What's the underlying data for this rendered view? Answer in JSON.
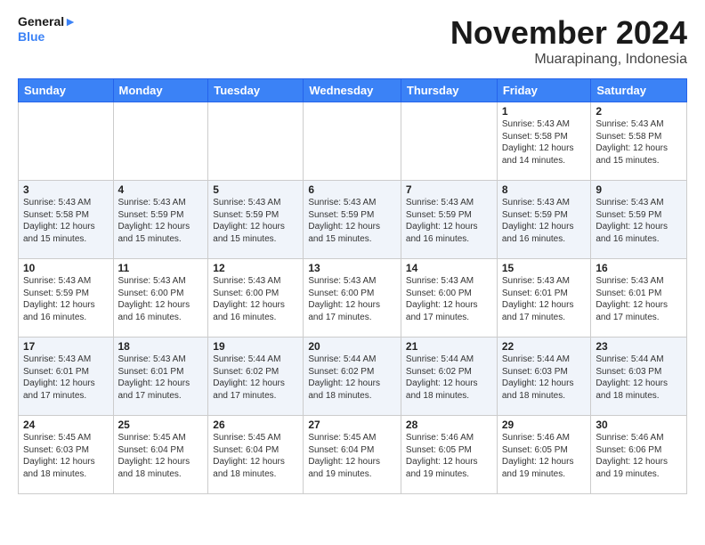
{
  "logo": {
    "line1": "General",
    "line2": "Blue"
  },
  "title": "November 2024",
  "location": "Muarapinang, Indonesia",
  "weekdays": [
    "Sunday",
    "Monday",
    "Tuesday",
    "Wednesday",
    "Thursday",
    "Friday",
    "Saturday"
  ],
  "weeks": [
    [
      {
        "day": "",
        "info": ""
      },
      {
        "day": "",
        "info": ""
      },
      {
        "day": "",
        "info": ""
      },
      {
        "day": "",
        "info": ""
      },
      {
        "day": "",
        "info": ""
      },
      {
        "day": "1",
        "info": "Sunrise: 5:43 AM\nSunset: 5:58 PM\nDaylight: 12 hours and 14 minutes."
      },
      {
        "day": "2",
        "info": "Sunrise: 5:43 AM\nSunset: 5:58 PM\nDaylight: 12 hours and 15 minutes."
      }
    ],
    [
      {
        "day": "3",
        "info": "Sunrise: 5:43 AM\nSunset: 5:58 PM\nDaylight: 12 hours and 15 minutes."
      },
      {
        "day": "4",
        "info": "Sunrise: 5:43 AM\nSunset: 5:59 PM\nDaylight: 12 hours and 15 minutes."
      },
      {
        "day": "5",
        "info": "Sunrise: 5:43 AM\nSunset: 5:59 PM\nDaylight: 12 hours and 15 minutes."
      },
      {
        "day": "6",
        "info": "Sunrise: 5:43 AM\nSunset: 5:59 PM\nDaylight: 12 hours and 15 minutes."
      },
      {
        "day": "7",
        "info": "Sunrise: 5:43 AM\nSunset: 5:59 PM\nDaylight: 12 hours and 16 minutes."
      },
      {
        "day": "8",
        "info": "Sunrise: 5:43 AM\nSunset: 5:59 PM\nDaylight: 12 hours and 16 minutes."
      },
      {
        "day": "9",
        "info": "Sunrise: 5:43 AM\nSunset: 5:59 PM\nDaylight: 12 hours and 16 minutes."
      }
    ],
    [
      {
        "day": "10",
        "info": "Sunrise: 5:43 AM\nSunset: 5:59 PM\nDaylight: 12 hours and 16 minutes."
      },
      {
        "day": "11",
        "info": "Sunrise: 5:43 AM\nSunset: 6:00 PM\nDaylight: 12 hours and 16 minutes."
      },
      {
        "day": "12",
        "info": "Sunrise: 5:43 AM\nSunset: 6:00 PM\nDaylight: 12 hours and 16 minutes."
      },
      {
        "day": "13",
        "info": "Sunrise: 5:43 AM\nSunset: 6:00 PM\nDaylight: 12 hours and 17 minutes."
      },
      {
        "day": "14",
        "info": "Sunrise: 5:43 AM\nSunset: 6:00 PM\nDaylight: 12 hours and 17 minutes."
      },
      {
        "day": "15",
        "info": "Sunrise: 5:43 AM\nSunset: 6:01 PM\nDaylight: 12 hours and 17 minutes."
      },
      {
        "day": "16",
        "info": "Sunrise: 5:43 AM\nSunset: 6:01 PM\nDaylight: 12 hours and 17 minutes."
      }
    ],
    [
      {
        "day": "17",
        "info": "Sunrise: 5:43 AM\nSunset: 6:01 PM\nDaylight: 12 hours and 17 minutes."
      },
      {
        "day": "18",
        "info": "Sunrise: 5:43 AM\nSunset: 6:01 PM\nDaylight: 12 hours and 17 minutes."
      },
      {
        "day": "19",
        "info": "Sunrise: 5:44 AM\nSunset: 6:02 PM\nDaylight: 12 hours and 17 minutes."
      },
      {
        "day": "20",
        "info": "Sunrise: 5:44 AM\nSunset: 6:02 PM\nDaylight: 12 hours and 18 minutes."
      },
      {
        "day": "21",
        "info": "Sunrise: 5:44 AM\nSunset: 6:02 PM\nDaylight: 12 hours and 18 minutes."
      },
      {
        "day": "22",
        "info": "Sunrise: 5:44 AM\nSunset: 6:03 PM\nDaylight: 12 hours and 18 minutes."
      },
      {
        "day": "23",
        "info": "Sunrise: 5:44 AM\nSunset: 6:03 PM\nDaylight: 12 hours and 18 minutes."
      }
    ],
    [
      {
        "day": "24",
        "info": "Sunrise: 5:45 AM\nSunset: 6:03 PM\nDaylight: 12 hours and 18 minutes."
      },
      {
        "day": "25",
        "info": "Sunrise: 5:45 AM\nSunset: 6:04 PM\nDaylight: 12 hours and 18 minutes."
      },
      {
        "day": "26",
        "info": "Sunrise: 5:45 AM\nSunset: 6:04 PM\nDaylight: 12 hours and 18 minutes."
      },
      {
        "day": "27",
        "info": "Sunrise: 5:45 AM\nSunset: 6:04 PM\nDaylight: 12 hours and 19 minutes."
      },
      {
        "day": "28",
        "info": "Sunrise: 5:46 AM\nSunset: 6:05 PM\nDaylight: 12 hours and 19 minutes."
      },
      {
        "day": "29",
        "info": "Sunrise: 5:46 AM\nSunset: 6:05 PM\nDaylight: 12 hours and 19 minutes."
      },
      {
        "day": "30",
        "info": "Sunrise: 5:46 AM\nSunset: 6:06 PM\nDaylight: 12 hours and 19 minutes."
      }
    ]
  ]
}
